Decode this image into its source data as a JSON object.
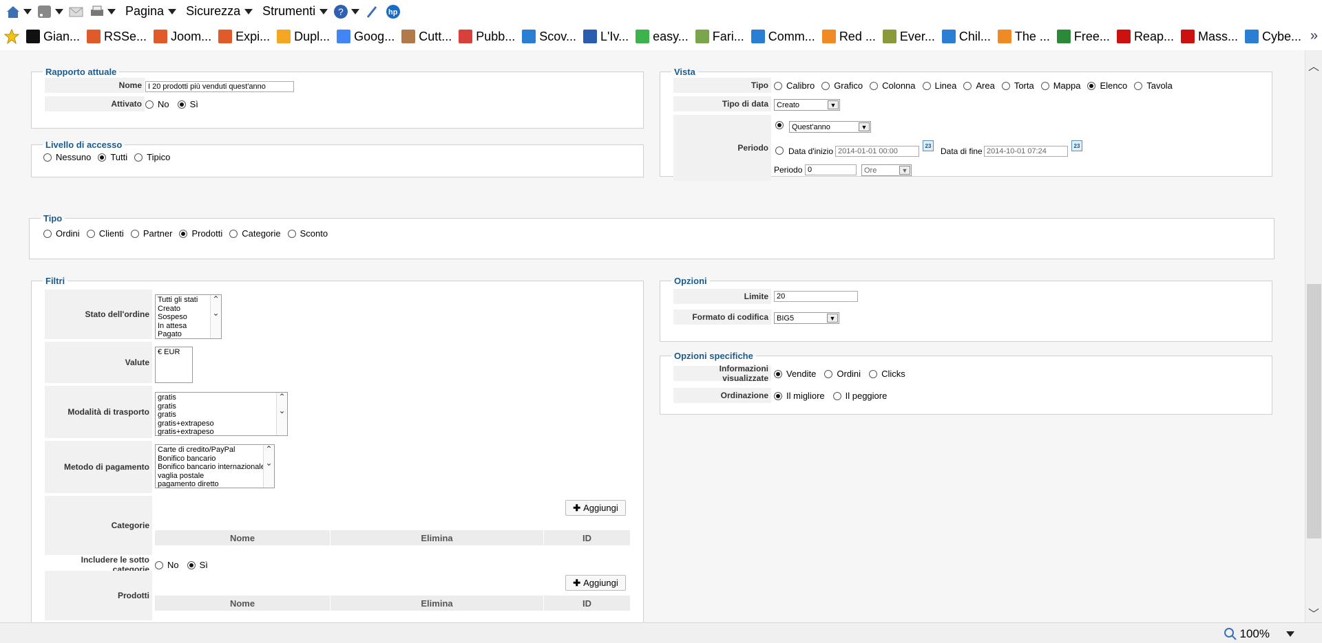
{
  "cmdbar": {
    "pagina": "Pagina",
    "sicurezza": "Sicurezza",
    "strumenti": "Strumenti"
  },
  "favorites": [
    {
      "label": "Gian...",
      "color": "#111111"
    },
    {
      "label": "RSSe...",
      "color": "#e05a2a"
    },
    {
      "label": "Joom...",
      "color": "#e05a2a"
    },
    {
      "label": "Expi...",
      "color": "#e05a2a"
    },
    {
      "label": "Dupl...",
      "color": "#f5a623"
    },
    {
      "label": "Goog...",
      "color": "#4285f4"
    },
    {
      "label": "Cutt...",
      "color": "#b27a4a"
    },
    {
      "label": "Pubb...",
      "color": "#d8413b"
    },
    {
      "label": "Scov...",
      "color": "#2a7fd4"
    },
    {
      "label": "L'Iv...",
      "color": "#2a5db0"
    },
    {
      "label": "easy...",
      "color": "#3cb44b"
    },
    {
      "label": "Fari...",
      "color": "#7aa54a"
    },
    {
      "label": "Comm...",
      "color": "#2a7fd4"
    },
    {
      "label": "Red ...",
      "color": "#f08a24"
    },
    {
      "label": "Ever...",
      "color": "#8a9a3a"
    },
    {
      "label": "Chil...",
      "color": "#2a7fd4"
    },
    {
      "label": "The ...",
      "color": "#f08a24"
    },
    {
      "label": "Free...",
      "color": "#2a8a3a"
    },
    {
      "label": "Reap...",
      "color": "#cc1111"
    },
    {
      "label": "Mass...",
      "color": "#cc1111"
    },
    {
      "label": "Cybe...",
      "color": "#2a7fd4"
    }
  ],
  "rapporto": {
    "legend": "Rapporto attuale",
    "nome_label": "Nome",
    "nome_value": "I 20 prodotti più venduti quest'anno",
    "attivato_label": "Attivato",
    "no": "No",
    "si": "Sì"
  },
  "livello": {
    "legend": "Livello di accesso",
    "options": [
      "Nessuno",
      "Tutti",
      "Tipico"
    ]
  },
  "vista": {
    "legend": "Vista",
    "tipo_label": "Tipo",
    "tipo_options": [
      "Calibro",
      "Grafico",
      "Colonna",
      "Linea",
      "Area",
      "Torta",
      "Mappa",
      "Elenco",
      "Tavola"
    ],
    "tipo_data_label": "Tipo di data",
    "tipo_data_value": "Creato",
    "periodo_label": "Periodo",
    "periodo_select": "Quest'anno",
    "data_inizio_label": "Data d'inizio",
    "data_inizio_value": "2014-01-01 00:00",
    "data_fine_label": "Data di fine",
    "data_fine_value": "2014-10-01 07:24",
    "periodo2_label": "Periodo",
    "periodo2_value": "0",
    "unit_value": "Ore",
    "cal_text": "23"
  },
  "tipo": {
    "legend": "Tipo",
    "options": [
      "Ordini",
      "Clienti",
      "Partner",
      "Prodotti",
      "Categorie",
      "Sconto"
    ]
  },
  "filtri": {
    "legend": "Filtri",
    "stato_label": "Stato dell'ordine",
    "stato_items": [
      "Tutti gli stati",
      "Creato",
      "Sospeso",
      "In attesa",
      "Pagato"
    ],
    "valute_label": "Valute",
    "valute_items": [
      "€ EUR"
    ],
    "trasporto_label": "Modalità di trasporto",
    "trasporto_items": [
      "gratis",
      "gratis",
      "gratis",
      "gratis+extrapeso",
      "gratis+extrapeso"
    ],
    "pagamento_label": "Metodo di pagamento",
    "pagamento_items": [
      "Carte di credito/PayPal",
      "Bonifico bancario",
      "Bonifico bancario internazionale",
      "vaglia postale",
      "pagamento diretto"
    ],
    "categorie_label": "Categorie",
    "aggiungi": "Aggiungi",
    "col_nome": "Nome",
    "col_elimina": "Elimina",
    "col_id": "ID",
    "sotto_label": "Includere le sotto categorie",
    "no": "No",
    "si": "Sì",
    "prodotti_label": "Prodotti"
  },
  "opzioni": {
    "legend": "Opzioni",
    "limite_label": "Limite",
    "limite_value": "20",
    "formato_label": "Formato di codifica",
    "formato_value": "BIG5"
  },
  "specifiche": {
    "legend": "Opzioni specifiche",
    "info_label": "Informazioni visualizzate",
    "info_options": [
      "Vendite",
      "Ordini",
      "Clicks"
    ],
    "ord_label": "Ordinazione",
    "ord_options": [
      "Il migliore",
      "Il peggiore"
    ]
  },
  "status": {
    "zoom": "100%"
  }
}
